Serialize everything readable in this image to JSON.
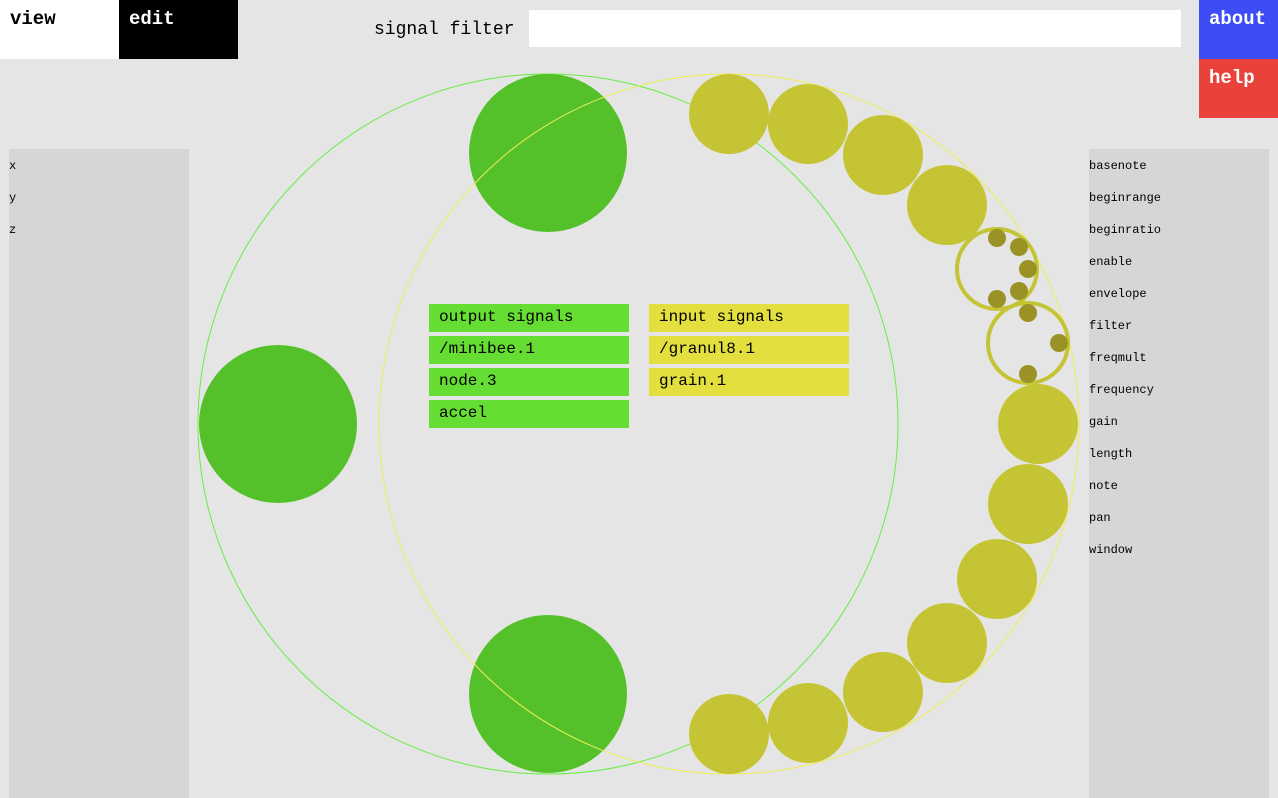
{
  "tabs": [
    {
      "label": "view"
    },
    {
      "label": "edit"
    }
  ],
  "filter": {
    "label": "signal filter",
    "value": "",
    "placeholder": ""
  },
  "buttons": {
    "about": "about",
    "help": "help"
  },
  "left_panel": {
    "items": [
      "x",
      "y",
      "z"
    ]
  },
  "right_panel": {
    "items": [
      "basenote",
      "beginrange",
      "beginratio",
      "enable",
      "envelope",
      "filter",
      "freqmult",
      "frequency",
      "gain",
      "length",
      "note",
      "pan",
      "window"
    ]
  },
  "output_list": [
    "output signals",
    "/minibee.1",
    "node.3",
    "accel"
  ],
  "input_list": [
    "input signals",
    "/granul8.1",
    "grain.1"
  ],
  "colors": {
    "output": "#55c12a",
    "output_box": "#66dd33",
    "input": "#c5c434",
    "input_box": "#e2df3f",
    "input_dark": "#9b9226",
    "about": "#3d4cf5",
    "help": "#e8423a"
  }
}
